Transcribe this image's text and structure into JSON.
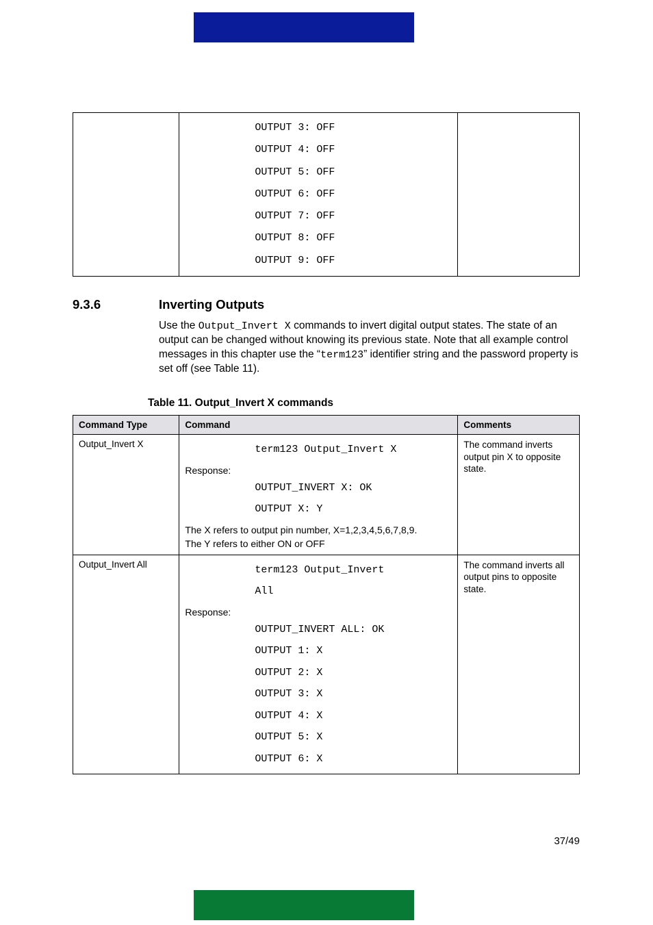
{
  "top_table": {
    "code_lines": "OUTPUT 3: OFF\nOUTPUT 4: OFF\nOUTPUT 5: OFF\nOUTPUT 6: OFF\nOUTPUT 7: OFF\nOUTPUT 8: OFF\nOUTPUT 9: OFF"
  },
  "section": {
    "number": "9.3.6",
    "title": "Inverting Outputs",
    "para_1": "Use the ",
    "para_code": "Output_Invert X",
    "para_2": " commands to invert digital output states. The state of an output can be changed without knowing its previous state. Note that all example control messages in this chapter use the “",
    "para_code2": "term123",
    "para_3": "” identifier string and the password property is set off (see Table 11)."
  },
  "table11": {
    "caption": "Table 11. Output_Invert X commands",
    "headers": {
      "c1": "Command Type",
      "c2": "Command",
      "c3": "Comments"
    },
    "rows": [
      {
        "type": "Output_Invert X",
        "cmd_first": "term123 Output_Invert X",
        "resp_label": "Response:",
        "resp_lines": "OUTPUT_INVERT X: OK\nOUTPUT X: Y",
        "note1": "The X refers to output pin number, X=1,2,3,4,5,6,7,8,9.",
        "note2": "The Y refers to either ON or OFF",
        "comments": "The command inverts output pin X to opposite state."
      },
      {
        "type": "Output_Invert All",
        "cmd_first": "term123 Output_Invert\nAll",
        "resp_label": "Response:",
        "resp_lines": "OUTPUT_INVERT ALL: OK\nOUTPUT 1: X\nOUTPUT 2: X\nOUTPUT 3: X\nOUTPUT 4: X\nOUTPUT 5: X\nOUTPUT 6: X",
        "comments": "The command inverts all output pins to opposite state."
      }
    ]
  },
  "page_number": "37/49"
}
